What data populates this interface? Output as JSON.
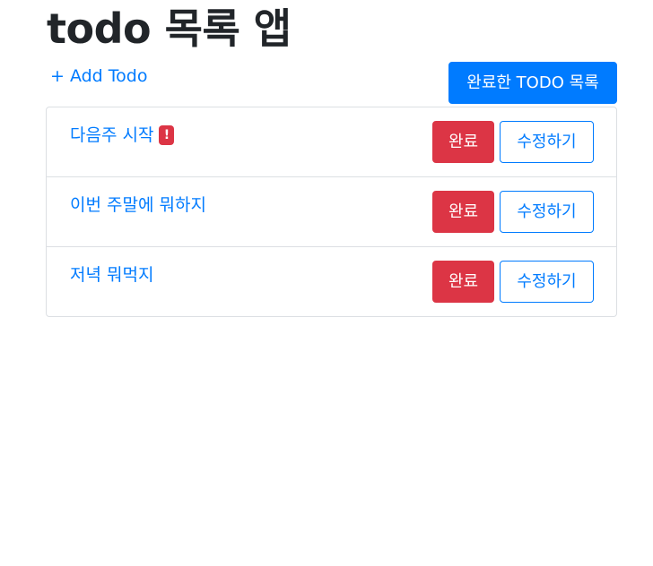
{
  "header": {
    "title": "todo 목록 앱",
    "add_link_label": "+ Add Todo",
    "completed_list_label": "완료한 TODO 목록"
  },
  "todos": [
    {
      "text": "다음주 시작",
      "badge": "!",
      "complete_label": "완료",
      "edit_label": "수정하기"
    },
    {
      "text": "이번 주말에 뭐하지",
      "complete_label": "완료",
      "edit_label": "수정하기"
    },
    {
      "text": "저녁 뭐먹지",
      "complete_label": "완료",
      "edit_label": "수정하기"
    }
  ],
  "colors": {
    "primary": "#007bff",
    "danger": "#dc3545",
    "border": "#dcdfe3"
  }
}
